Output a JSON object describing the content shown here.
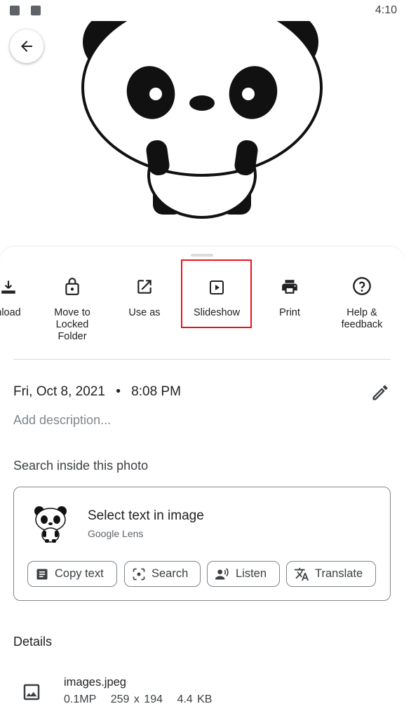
{
  "status_bar": {
    "time": "4:10",
    "icons": [
      "image-notification-icon",
      "font-notification-icon"
    ]
  },
  "photo": {
    "subject": "panda-illustration"
  },
  "back": {
    "icon": "arrow-back-icon"
  },
  "actions": [
    {
      "label": "nload",
      "icon": "download-icon"
    },
    {
      "label": "Move to Locked Folder",
      "icon": "lock-icon"
    },
    {
      "label": "Use as",
      "icon": "open-external-icon"
    },
    {
      "label": "Slideshow",
      "icon": "slideshow-icon",
      "highlighted": true
    },
    {
      "label": "Print",
      "icon": "printer-icon"
    },
    {
      "label": "Help & feedback",
      "icon": "help-icon"
    }
  ],
  "info": {
    "date": "Fri, Oct 8, 2021",
    "separator": "•",
    "time": "8:08 PM",
    "description_placeholder": "Add description..."
  },
  "search_inside": {
    "title": "Search inside this photo",
    "lens_title": "Select text in image",
    "lens_subtitle": "Google Lens",
    "chips": [
      {
        "label": "Copy text",
        "icon": "text-document-icon"
      },
      {
        "label": "Search",
        "icon": "lens-search-icon"
      },
      {
        "label": "Listen",
        "icon": "speaker-person-icon"
      },
      {
        "label": "Translate",
        "icon": "translate-icon"
      }
    ]
  },
  "details": {
    "title": "Details",
    "file_name": "images.jpeg",
    "megapixels": "0.1MP",
    "dimensions": "259 x 194",
    "size": "4.4 KB"
  },
  "colors": {
    "highlight": "#e8141b",
    "text": "#202124",
    "muted": "#80868b"
  }
}
